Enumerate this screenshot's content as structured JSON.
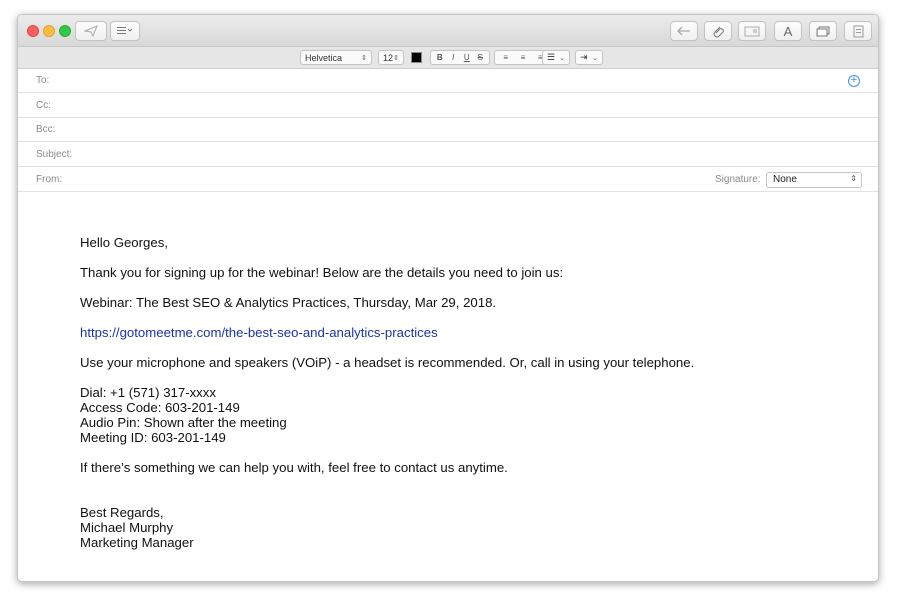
{
  "toolbar": {
    "send_icon": "paper-plane-icon",
    "header_fields_icon": "list-icon",
    "reply_icon": "undo-arrow-icon",
    "attach_icon": "paperclip-icon",
    "photo_icon": "photo-icon",
    "format_label": "A",
    "browser_icon": "window-icon",
    "markup_icon": "notepad-icon"
  },
  "format": {
    "font": "Helvetica",
    "size": "12",
    "color": "#000000",
    "bold": "B",
    "italic": "I",
    "underline": "U",
    "strike": "S"
  },
  "headers": {
    "to_label": "To:",
    "cc_label": "Cc:",
    "bcc_label": "Bcc:",
    "subject_label": "Subject:",
    "from_label": "From:",
    "signature_label": "Signature:",
    "signature_value": "None"
  },
  "message": {
    "greeting": "Hello Georges,",
    "intro": "Thank you for signing up for the webinar! Below are the details you need to join us:",
    "webinar": "Webinar: The Best SEO & Analytics Practices, Thursday, Mar 29, 2018.",
    "link": "https://gotomeetme.com/the-best-seo-and-analytics-practices",
    "audio": "Use your microphone and speakers (VOiP) - a headset is recommended. Or, call in using your telephone.",
    "dial": "Dial: +1 (571) 317-xxxx",
    "access_code": "Access Code: 603-201-149",
    "audio_pin": "Audio Pin: Shown after the meeting",
    "meeting_id": "Meeting ID: 603-201-149",
    "help": "If there’s something we can help you with, feel free to contact us anytime.",
    "closing": "Best Regards,",
    "sender_name": "Michael Murphy",
    "sender_title": "Marketing Manager"
  }
}
